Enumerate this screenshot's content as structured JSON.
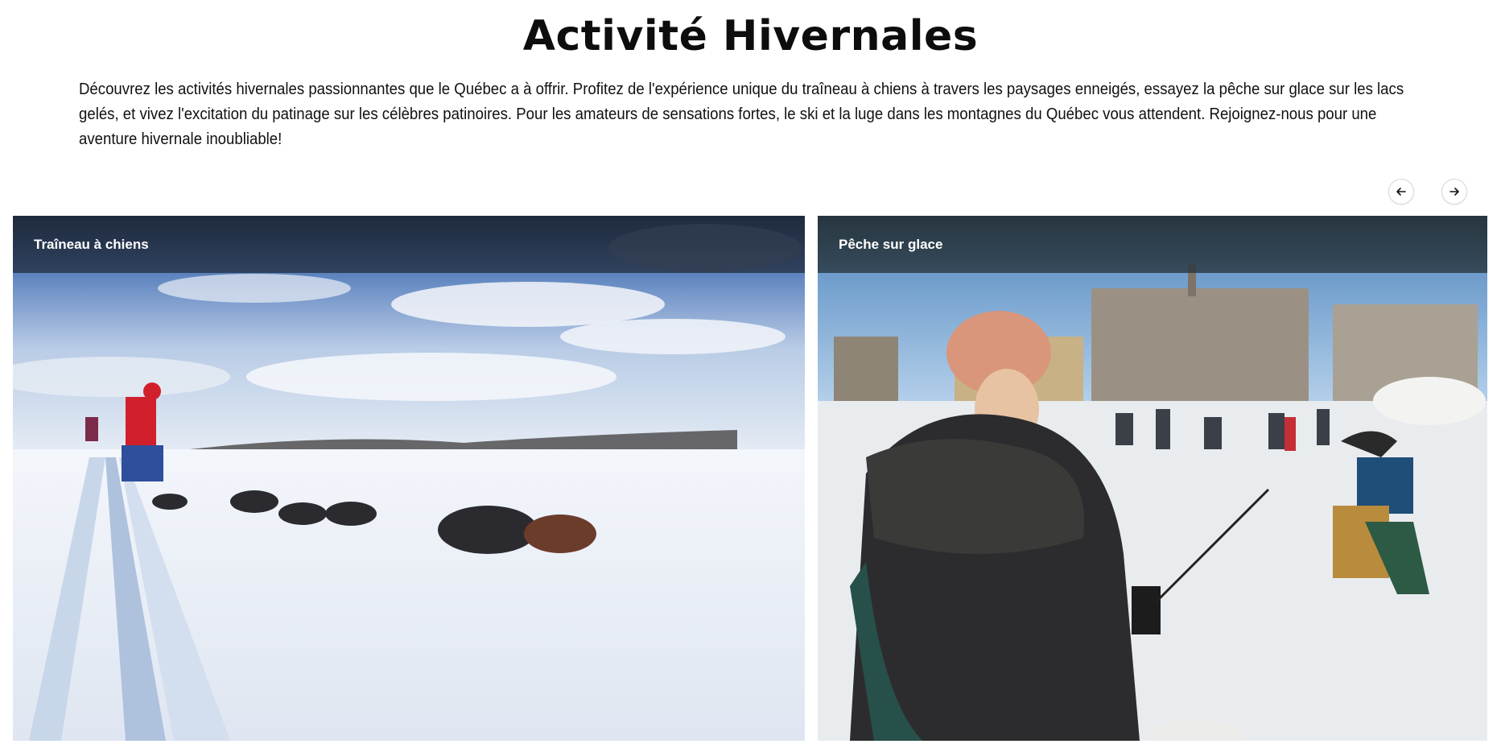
{
  "header": {
    "title": "Activité Hivernales"
  },
  "intro": {
    "text": "Découvrez les activités hivernales passionnantes que le Québec a à offrir. Profitez de l'expérience unique du traîneau à chiens à travers les paysages enneigés, essayez la pêche sur glace sur les lacs gelés, et vivez l'excitation du patinage sur les célèbres patinoires. Pour les amateurs de sensations fortes, le ski et la luge dans les montagnes du Québec vous attendent. Rejoignez-nous pour une aventure hivernale inoubliable!"
  },
  "carousel": {
    "prev_icon": "arrow-left-icon",
    "next_icon": "arrow-right-icon",
    "cards": [
      {
        "label": "Traîneau à chiens",
        "image": "dog-sledding-photo"
      },
      {
        "label": "Pêche sur glace",
        "image": "ice-fishing-photo"
      }
    ]
  },
  "colors": {
    "text": "#111111",
    "card_header_overlay": "#1e2a3a",
    "background": "#ffffff"
  }
}
